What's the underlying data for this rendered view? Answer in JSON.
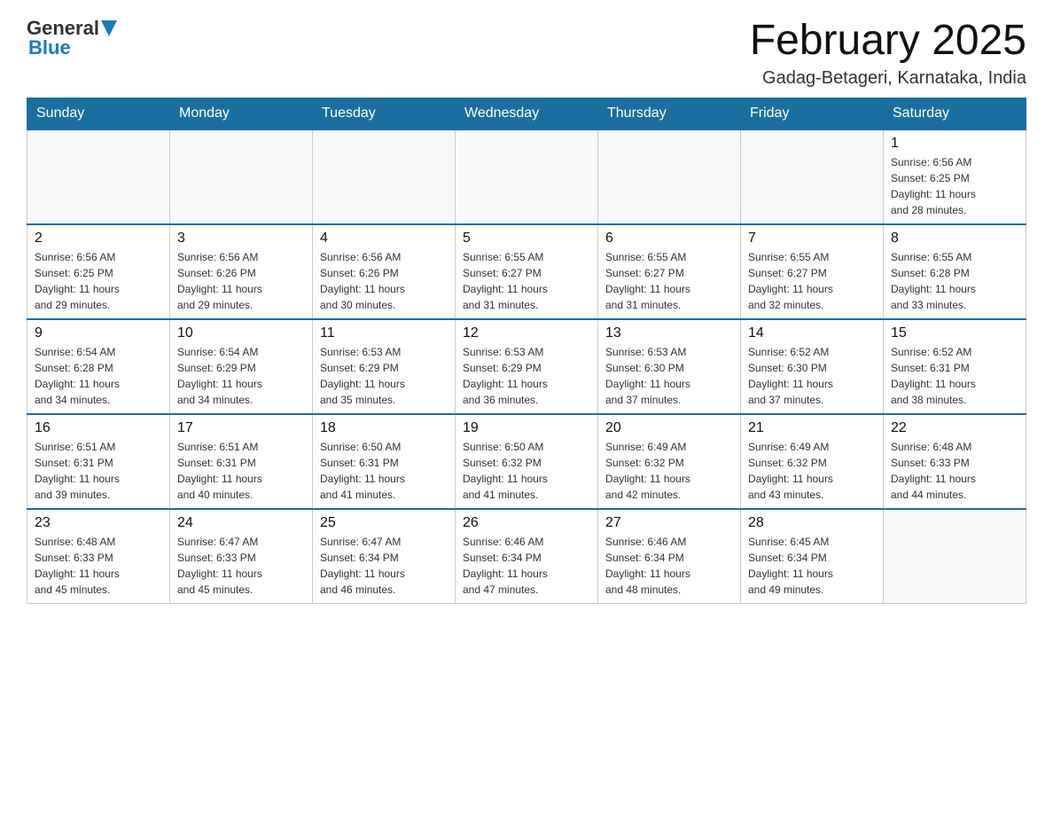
{
  "header": {
    "logo_general": "General",
    "logo_blue": "Blue",
    "title": "February 2025",
    "location": "Gadag-Betageri, Karnataka, India"
  },
  "days_of_week": [
    "Sunday",
    "Monday",
    "Tuesday",
    "Wednesday",
    "Thursday",
    "Friday",
    "Saturday"
  ],
  "weeks": [
    [
      {
        "day": "",
        "info": ""
      },
      {
        "day": "",
        "info": ""
      },
      {
        "day": "",
        "info": ""
      },
      {
        "day": "",
        "info": ""
      },
      {
        "day": "",
        "info": ""
      },
      {
        "day": "",
        "info": ""
      },
      {
        "day": "1",
        "info": "Sunrise: 6:56 AM\nSunset: 6:25 PM\nDaylight: 11 hours\nand 28 minutes."
      }
    ],
    [
      {
        "day": "2",
        "info": "Sunrise: 6:56 AM\nSunset: 6:25 PM\nDaylight: 11 hours\nand 29 minutes."
      },
      {
        "day": "3",
        "info": "Sunrise: 6:56 AM\nSunset: 6:26 PM\nDaylight: 11 hours\nand 29 minutes."
      },
      {
        "day": "4",
        "info": "Sunrise: 6:56 AM\nSunset: 6:26 PM\nDaylight: 11 hours\nand 30 minutes."
      },
      {
        "day": "5",
        "info": "Sunrise: 6:55 AM\nSunset: 6:27 PM\nDaylight: 11 hours\nand 31 minutes."
      },
      {
        "day": "6",
        "info": "Sunrise: 6:55 AM\nSunset: 6:27 PM\nDaylight: 11 hours\nand 31 minutes."
      },
      {
        "day": "7",
        "info": "Sunrise: 6:55 AM\nSunset: 6:27 PM\nDaylight: 11 hours\nand 32 minutes."
      },
      {
        "day": "8",
        "info": "Sunrise: 6:55 AM\nSunset: 6:28 PM\nDaylight: 11 hours\nand 33 minutes."
      }
    ],
    [
      {
        "day": "9",
        "info": "Sunrise: 6:54 AM\nSunset: 6:28 PM\nDaylight: 11 hours\nand 34 minutes."
      },
      {
        "day": "10",
        "info": "Sunrise: 6:54 AM\nSunset: 6:29 PM\nDaylight: 11 hours\nand 34 minutes."
      },
      {
        "day": "11",
        "info": "Sunrise: 6:53 AM\nSunset: 6:29 PM\nDaylight: 11 hours\nand 35 minutes."
      },
      {
        "day": "12",
        "info": "Sunrise: 6:53 AM\nSunset: 6:29 PM\nDaylight: 11 hours\nand 36 minutes."
      },
      {
        "day": "13",
        "info": "Sunrise: 6:53 AM\nSunset: 6:30 PM\nDaylight: 11 hours\nand 37 minutes."
      },
      {
        "day": "14",
        "info": "Sunrise: 6:52 AM\nSunset: 6:30 PM\nDaylight: 11 hours\nand 37 minutes."
      },
      {
        "day": "15",
        "info": "Sunrise: 6:52 AM\nSunset: 6:31 PM\nDaylight: 11 hours\nand 38 minutes."
      }
    ],
    [
      {
        "day": "16",
        "info": "Sunrise: 6:51 AM\nSunset: 6:31 PM\nDaylight: 11 hours\nand 39 minutes."
      },
      {
        "day": "17",
        "info": "Sunrise: 6:51 AM\nSunset: 6:31 PM\nDaylight: 11 hours\nand 40 minutes."
      },
      {
        "day": "18",
        "info": "Sunrise: 6:50 AM\nSunset: 6:31 PM\nDaylight: 11 hours\nand 41 minutes."
      },
      {
        "day": "19",
        "info": "Sunrise: 6:50 AM\nSunset: 6:32 PM\nDaylight: 11 hours\nand 41 minutes."
      },
      {
        "day": "20",
        "info": "Sunrise: 6:49 AM\nSunset: 6:32 PM\nDaylight: 11 hours\nand 42 minutes."
      },
      {
        "day": "21",
        "info": "Sunrise: 6:49 AM\nSunset: 6:32 PM\nDaylight: 11 hours\nand 43 minutes."
      },
      {
        "day": "22",
        "info": "Sunrise: 6:48 AM\nSunset: 6:33 PM\nDaylight: 11 hours\nand 44 minutes."
      }
    ],
    [
      {
        "day": "23",
        "info": "Sunrise: 6:48 AM\nSunset: 6:33 PM\nDaylight: 11 hours\nand 45 minutes."
      },
      {
        "day": "24",
        "info": "Sunrise: 6:47 AM\nSunset: 6:33 PM\nDaylight: 11 hours\nand 45 minutes."
      },
      {
        "day": "25",
        "info": "Sunrise: 6:47 AM\nSunset: 6:34 PM\nDaylight: 11 hours\nand 46 minutes."
      },
      {
        "day": "26",
        "info": "Sunrise: 6:46 AM\nSunset: 6:34 PM\nDaylight: 11 hours\nand 47 minutes."
      },
      {
        "day": "27",
        "info": "Sunrise: 6:46 AM\nSunset: 6:34 PM\nDaylight: 11 hours\nand 48 minutes."
      },
      {
        "day": "28",
        "info": "Sunrise: 6:45 AM\nSunset: 6:34 PM\nDaylight: 11 hours\nand 49 minutes."
      },
      {
        "day": "",
        "info": ""
      }
    ]
  ]
}
